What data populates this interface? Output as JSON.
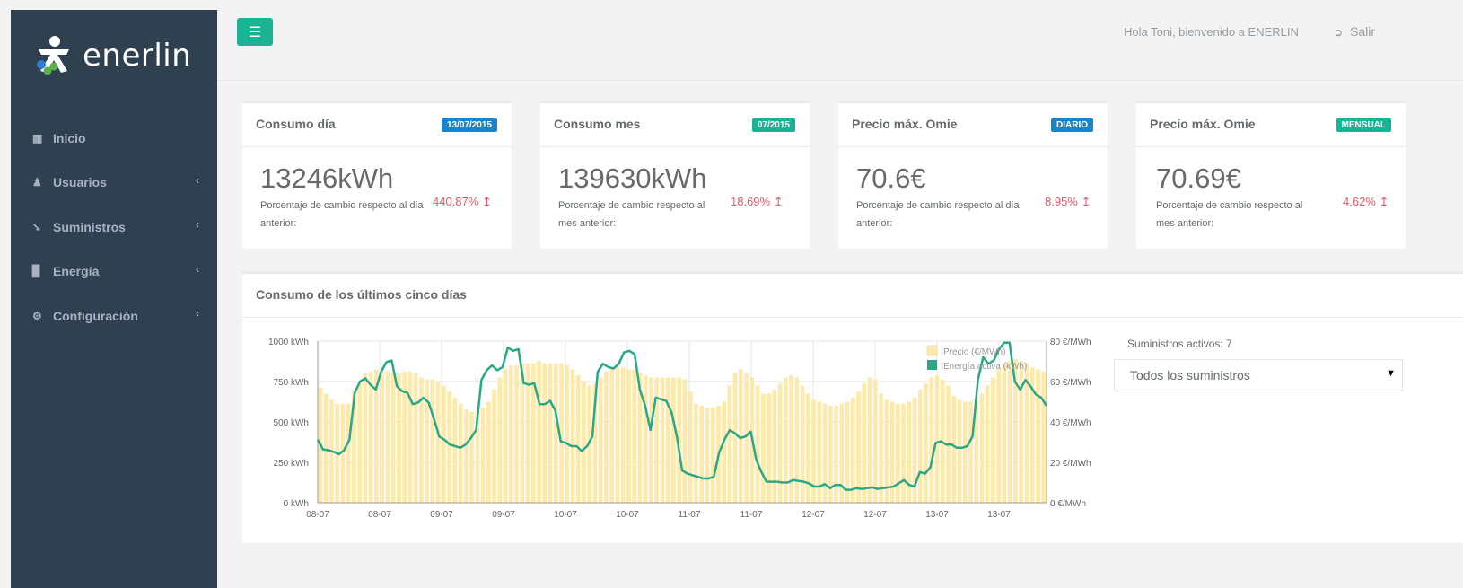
{
  "app": {
    "brand": "enerlin"
  },
  "sidebar": {
    "items": [
      {
        "label": "Inicio",
        "icon": "th-large-icon",
        "has_arrow": false
      },
      {
        "label": "Usuarios",
        "icon": "user-icon",
        "has_arrow": true
      },
      {
        "label": "Suministros",
        "icon": "plug-icon",
        "has_arrow": true
      },
      {
        "label": "Energía",
        "icon": "bar-chart-icon",
        "has_arrow": true
      },
      {
        "label": "Configuración",
        "icon": "gear-icon",
        "has_arrow": true
      }
    ]
  },
  "topbar": {
    "menu_icon": "hamburger-icon",
    "welcome": "Hola Toni, bienvenido a ENERLIN",
    "logout_label": "Salir",
    "logout_icon": "sign-out-icon"
  },
  "colors": {
    "accent": "#1ab394",
    "blue": "#1c84c6",
    "danger": "#ed5565",
    "sidebar": "#2f4050",
    "bar": "#fde9a9",
    "line": "#27a887"
  },
  "cards": [
    {
      "title": "Consumo día",
      "badge": "13/07/2015",
      "badge_color": "blue",
      "value": "13246kWh",
      "description": "Porcentaje de cambio respecto al día anterior:",
      "change": "440.87%",
      "trend_icon": "level-up-icon"
    },
    {
      "title": "Consumo mes",
      "badge": "07/2015",
      "badge_color": "green",
      "value": "139630kWh",
      "description": "Porcentaje de cambio respecto al mes anterior:",
      "change": "18.69%",
      "trend_icon": "level-up-icon"
    },
    {
      "title": "Precio máx. Omie",
      "badge": "DIARIO",
      "badge_color": "blue",
      "value": "70.6€",
      "description": "Porcentaje de cambio respecto al día anterior:",
      "change": "8.95%",
      "trend_icon": "level-up-icon"
    },
    {
      "title": "Precio máx. Omie",
      "badge": "MENSUAL",
      "badge_color": "green",
      "value": "70.69€",
      "description": "Porcentaje de cambio respecto al mes anterior:",
      "change": "4.62%",
      "trend_icon": "level-up-icon"
    }
  ],
  "chart_panel": {
    "title": "Consumo de los últimos cinco días",
    "active_label": "Suministros activos: 7",
    "select_value": "Todos los suministros"
  },
  "chart_data": {
    "type": "bar",
    "x_tick_labels": [
      "08-07",
      "08-07",
      "09-07",
      "09-07",
      "10-07",
      "10-07",
      "11-07",
      "11-07",
      "12-07",
      "12-07",
      "13-07",
      "13-07"
    ],
    "y_left": {
      "unit": "kWh",
      "range": [
        0,
        1000
      ],
      "ticks": [
        "0 kWh",
        "250 kWh",
        "500 kWh",
        "750 kWh",
        "1000 kWh"
      ]
    },
    "y_right": {
      "unit": "€/MWh",
      "range": [
        0,
        80
      ],
      "ticks": [
        "0 €/MWh",
        "20 €/MWh",
        "40 €/MWh",
        "60 €/MWh",
        "80 €/MWh"
      ]
    },
    "legend_position": "top-right",
    "grid": true,
    "series": [
      {
        "name": "Precio (€/MWh)",
        "type": "bar",
        "axis": "right",
        "color": "#fde9a9",
        "values": [
          57,
          54,
          51,
          49,
          49,
          49,
          56,
          59,
          64,
          65,
          66,
          65,
          65,
          64,
          64,
          65,
          65,
          64,
          62,
          61,
          61,
          60,
          58,
          55,
          52,
          49,
          46,
          45,
          45,
          47,
          50,
          56,
          62,
          66,
          68,
          68,
          69,
          69,
          69,
          70,
          69,
          69,
          69,
          69,
          68,
          66,
          63,
          60,
          58,
          59,
          62,
          65,
          67,
          67,
          67,
          66,
          66,
          64,
          63,
          62,
          62,
          62,
          62,
          62,
          62,
          61,
          55,
          49,
          48,
          47,
          47,
          48,
          50,
          58,
          64,
          66,
          64,
          62,
          58,
          54,
          54,
          56,
          59,
          62,
          63,
          62,
          58,
          54,
          51,
          50,
          49,
          48,
          48,
          49,
          50,
          52,
          55,
          59,
          62,
          61,
          54,
          51,
          50,
          49,
          49,
          50,
          52,
          56,
          59,
          62,
          63,
          61,
          58,
          53,
          51,
          50,
          50,
          51,
          54,
          58,
          62,
          66,
          68,
          70,
          71,
          70,
          69,
          67,
          66,
          65
        ]
      },
      {
        "name": "Energía activa (kWh)",
        "type": "line",
        "axis": "left",
        "color": "#27a887",
        "values": [
          390,
          330,
          325,
          315,
          300,
          325,
          390,
          680,
          750,
          770,
          730,
          700,
          810,
          870,
          880,
          720,
          690,
          680,
          610,
          620,
          650,
          620,
          520,
          410,
          390,
          360,
          350,
          340,
          360,
          400,
          450,
          760,
          820,
          850,
          820,
          840,
          960,
          940,
          950,
          740,
          730,
          740,
          610,
          610,
          630,
          570,
          380,
          370,
          350,
          350,
          320,
          350,
          410,
          810,
          860,
          840,
          830,
          860,
          930,
          940,
          920,
          700,
          600,
          450,
          650,
          640,
          630,
          560,
          410,
          200,
          180,
          170,
          160,
          150,
          150,
          160,
          310,
          390,
          450,
          430,
          400,
          410,
          440,
          270,
          190,
          130,
          130,
          130,
          125,
          125,
          140,
          135,
          130,
          120,
          100,
          100,
          115,
          90,
          110,
          110,
          80,
          80,
          90,
          85,
          90,
          95,
          85,
          90,
          95,
          100,
          120,
          140,
          110,
          100,
          190,
          180,
          220,
          370,
          380,
          360,
          360,
          340,
          340,
          350,
          410,
          760,
          900,
          860,
          880,
          950,
          990,
          990,
          750,
          700,
          760,
          720,
          670,
          650,
          600
        ]
      }
    ]
  }
}
